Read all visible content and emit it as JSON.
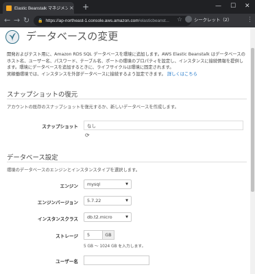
{
  "browser": {
    "tab_title": "Elastic Beanstalk マネジメントコンソ",
    "tab_close": "×",
    "new_tab": "+",
    "url_main": "https://ap-northeast-1.console.aws.amazon.com",
    "url_rest": "/elasticbeanst...",
    "profile_label": "シークレット（2）",
    "window_min": "—",
    "window_max": "☐",
    "window_close": "✕",
    "back": "←",
    "forward": "→",
    "reload": "↻",
    "star": "☆",
    "menu": "⋮"
  },
  "page": {
    "title": "データベースの変更",
    "intro_text": "開発およびテスト用に、Amazon RDS SQL データベースを環境に追加します。AWS Elastic Beanstalk はデータベースのホスト名、ユーザー名、パスワード、テーブル名、ポートの環境のプロパティを設定し、インスタンスに接続情報を提供します。環境にデータベースを追加するときに、ライフサイクルは環境に固定されます。",
    "intro_text2": "実稼働環境では、インスタンスを外部データベースに接続するよう設定できます。",
    "learn_more": "詳しくはこちら"
  },
  "snapshot_section": {
    "title": "スナップショットの復元",
    "description": "アカウントの既存のスナップショットを復元するか、新しいデータベースを作成します。",
    "snapshot_label": "スナップショット",
    "snapshot_value": "なし",
    "refresh_icon": "⟳"
  },
  "db_section": {
    "title": "データベース設定",
    "description": "環境のデータベースのエンジンとインスタンスタイプを選択します。",
    "engine_label": "エンジン",
    "engine_value": "mysql",
    "engine_version_label": "エンジンバージョン",
    "engine_version_value": "5.7.22",
    "instance_class_label": "インスタンスクラス",
    "instance_class_value": "db.t2.micro",
    "storage_label": "ストレージ",
    "storage_value": "5",
    "storage_unit": "GB",
    "storage_hint": "5 GB ～ 1024 GB を入力します。",
    "username_label": "ユーザー名",
    "username_value": "",
    "caret": "▼"
  },
  "colors": {
    "link": "#1a73c8",
    "chrome_dark": "#202124",
    "chrome_toolbar": "#35363a"
  }
}
